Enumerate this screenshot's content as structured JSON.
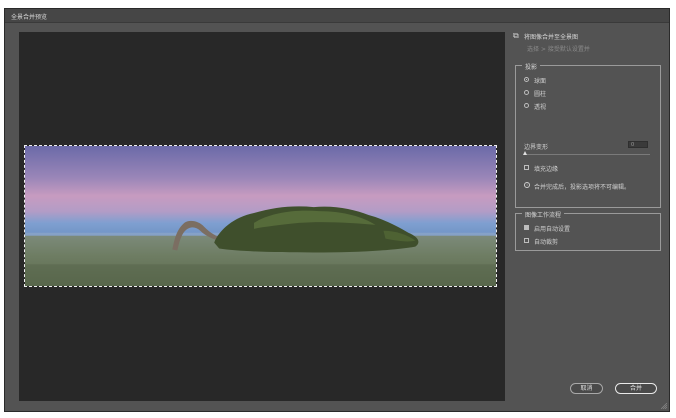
{
  "window": {
    "title": "全景合并预览"
  },
  "options": {
    "merge_layers_label": "将图像合并至全景图",
    "merge_layers_hint": "选择 > 接受默认设置并"
  },
  "projection": {
    "legend": "投影",
    "items": [
      {
        "label": "球面",
        "selected": true
      },
      {
        "label": "圆柱",
        "selected": false
      },
      {
        "label": "透视",
        "selected": false
      }
    ],
    "boundary_warp_label": "边界变形",
    "boundary_warp_value": "0",
    "fill_edges_label": "填充边缘",
    "info_text": "合并完成后，投影选项将不可编辑。"
  },
  "image_workflow": {
    "legend": "图像工作流程",
    "items": [
      {
        "label": "启用自动设置",
        "checked": true
      },
      {
        "label": "自动裁剪",
        "checked": false
      }
    ]
  },
  "buttons": {
    "cancel": "取消",
    "merge": "合并"
  },
  "icons": {
    "merge_layers": "layers-icon",
    "info": "info-icon",
    "resize": "resize-grip-icon"
  }
}
